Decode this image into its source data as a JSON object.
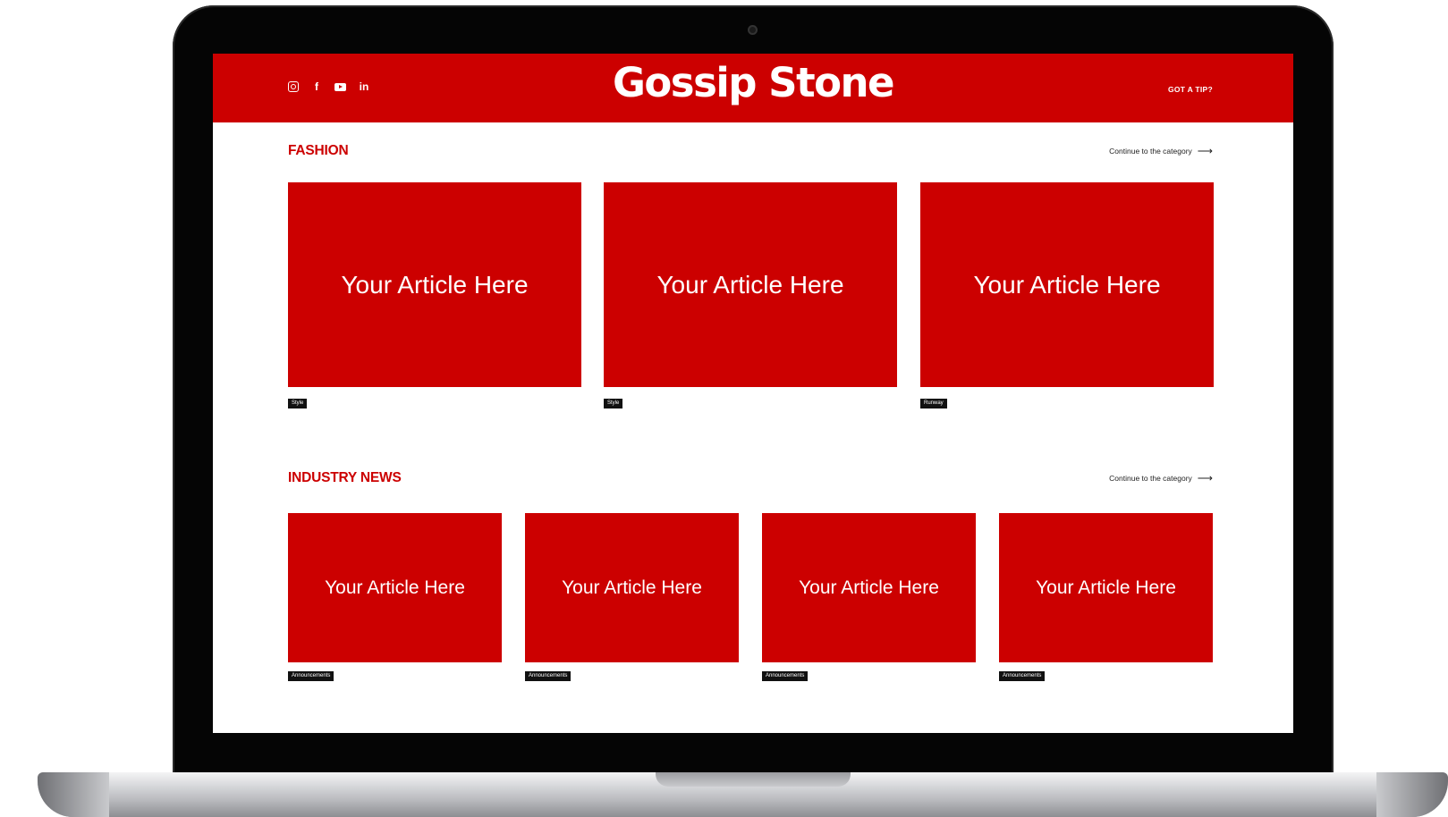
{
  "header": {
    "logo": "Gossip Stone",
    "tip_label": "GOT A TIP?",
    "social_icons": [
      "instagram-icon",
      "facebook-icon",
      "youtube-icon",
      "linkedin-icon"
    ],
    "facebook_glyph": "f",
    "linkedin_glyph": "in"
  },
  "sections": [
    {
      "title": "FASHION",
      "continue_label": "Continue to the category",
      "cards": [
        {
          "text": "Your Article Here",
          "tag": "Style"
        },
        {
          "text": "Your Article Here",
          "tag": "Style"
        },
        {
          "text": "Your Article Here",
          "tag": "Runway"
        }
      ]
    },
    {
      "title": "INDUSTRY NEWS",
      "continue_label": "Continue to the category",
      "cards": [
        {
          "text": "Your Article Here",
          "tag": "Announcements"
        },
        {
          "text": "Your Article Here",
          "tag": "Announcements"
        },
        {
          "text": "Your Article Here",
          "tag": "Announcements"
        },
        {
          "text": "Your Article Here",
          "tag": "Announcements"
        }
      ]
    }
  ],
  "colors": {
    "brand": "#cc0000",
    "tag_bg": "#111111",
    "bezel": "#050505"
  }
}
